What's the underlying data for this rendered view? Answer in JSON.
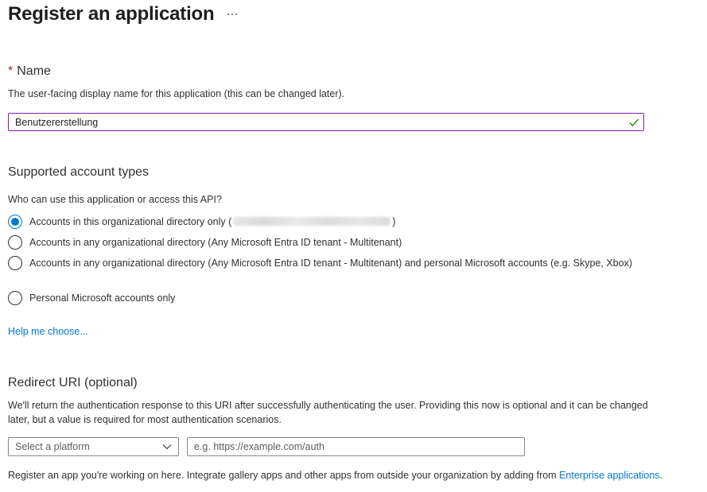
{
  "header": {
    "title": "Register an application",
    "more_label": "···"
  },
  "name_section": {
    "required_marker": "*",
    "heading": "Name",
    "description": "The user-facing display name for this application (this can be changed later).",
    "value": "Benutzererstellung",
    "valid": true
  },
  "account_types": {
    "heading": "Supported account types",
    "question": "Who can use this application or access this API?",
    "options": [
      {
        "label_prefix": "Accounts in this organizational directory only (",
        "label_redacted": true,
        "label_suffix": ")",
        "selected": true
      },
      {
        "label": "Accounts in any organizational directory (Any Microsoft Entra ID tenant - Multitenant)",
        "selected": false
      },
      {
        "label": "Accounts in any organizational directory (Any Microsoft Entra ID tenant - Multitenant) and personal Microsoft accounts (e.g. Skype, Xbox)",
        "selected": false
      },
      {
        "label": "Personal Microsoft accounts only",
        "selected": false
      }
    ],
    "help_link": "Help me choose..."
  },
  "redirect_uri": {
    "heading": "Redirect URI (optional)",
    "description": "We'll return the authentication response to this URI after successfully authenticating the user. Providing this now is optional and it can be changed later, but a value is required for most authentication scenarios.",
    "platform_select_value": "Select a platform",
    "uri_placeholder": "e.g. https://example.com/auth",
    "uri_value": ""
  },
  "footer": {
    "text": "Register an app you're working on here. Integrate gallery apps and other apps from outside your organization by adding from ",
    "link": "Enterprise applications",
    "suffix": "."
  },
  "colors": {
    "accent": "#0078d4",
    "required": "#a4262c",
    "focus_border": "#8a1ea8",
    "valid_check": "#107c10"
  }
}
